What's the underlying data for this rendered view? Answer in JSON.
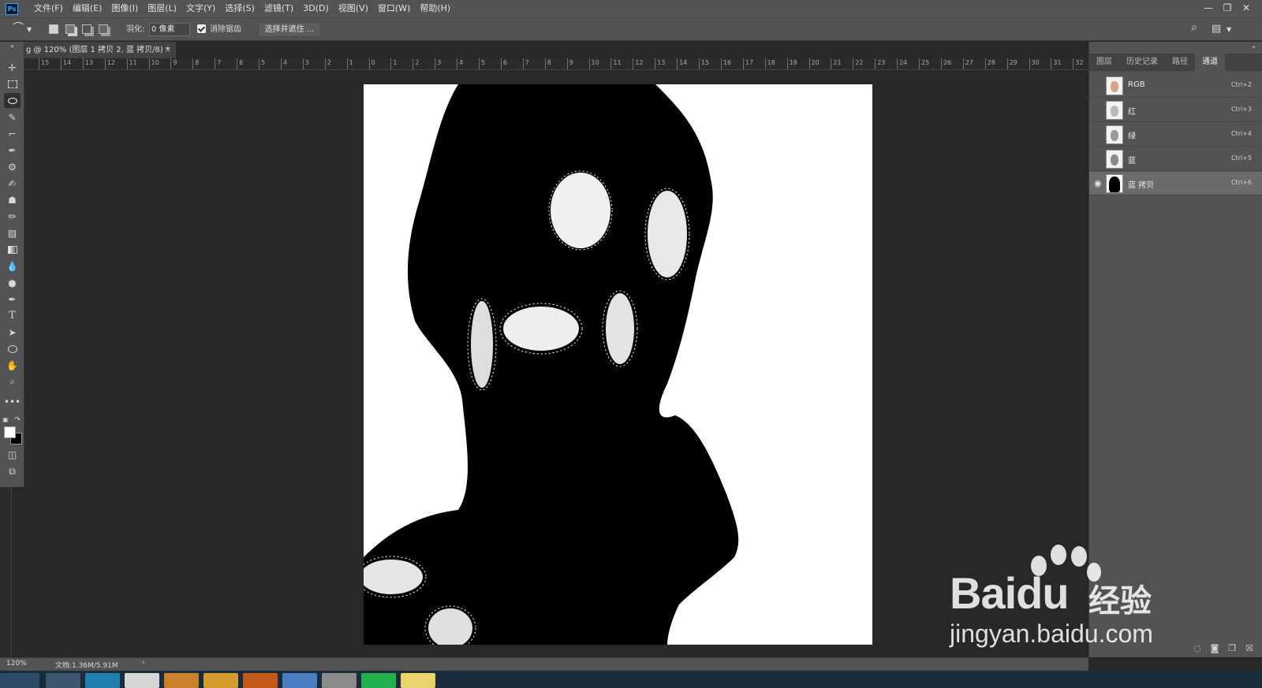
{
  "menubar": {
    "logo": "Ps",
    "items": [
      "文件(F)",
      "编辑(E)",
      "图像(I)",
      "图层(L)",
      "文字(Y)",
      "选择(S)",
      "滤镜(T)",
      "3D(D)",
      "视图(V)",
      "窗口(W)",
      "帮助(H)"
    ],
    "win_min": "—",
    "win_restore": "❐",
    "win_close": "✕"
  },
  "options": {
    "feather_label": "羽化:",
    "feather_value": "0 像素",
    "antialias_label": "消除锯齿",
    "antialias_checked": true,
    "select_mask_label": "选择并遮住 ..."
  },
  "document": {
    "tab_title": "g @ 120% (图层 1 拷贝 2, 蓝 拷贝/8) *",
    "tab_close": "×"
  },
  "ruler": {
    "labels": [
      "15",
      "14",
      "13",
      "12",
      "11",
      "10",
      "9",
      "8",
      "7",
      "6",
      "5",
      "4",
      "3",
      "2",
      "1",
      "0",
      "1",
      "2",
      "3",
      "4",
      "5",
      "6",
      "7",
      "8",
      "9",
      "10",
      "11",
      "12",
      "13",
      "14",
      "15",
      "16",
      "17",
      "18",
      "19",
      "20",
      "21",
      "22",
      "23",
      "24",
      "25",
      "26",
      "27",
      "28",
      "29",
      "30",
      "31",
      "32"
    ]
  },
  "panel": {
    "tabs": [
      "图层",
      "历史记录",
      "路径",
      "通道"
    ],
    "active_tab": "通道",
    "channels": [
      {
        "name": "RGB",
        "shortcut": "Ctrl+2",
        "visible": false
      },
      {
        "name": "红",
        "shortcut": "Ctrl+3",
        "visible": false
      },
      {
        "name": "绿",
        "shortcut": "Ctrl+4",
        "visible": false
      },
      {
        "name": "蓝",
        "shortcut": "Ctrl+5",
        "visible": false
      },
      {
        "name": "蓝 拷贝",
        "shortcut": "Ctrl+6",
        "visible": true,
        "selected": true
      }
    ]
  },
  "status": {
    "zoom": "120%",
    "doc_info": "文档:1.36M/5.91M",
    "arrow": "›"
  },
  "watermark": {
    "brand": "Bai",
    "brand_suffix": "du",
    "cn": "经验",
    "url": "jingyan.baidu.com"
  }
}
